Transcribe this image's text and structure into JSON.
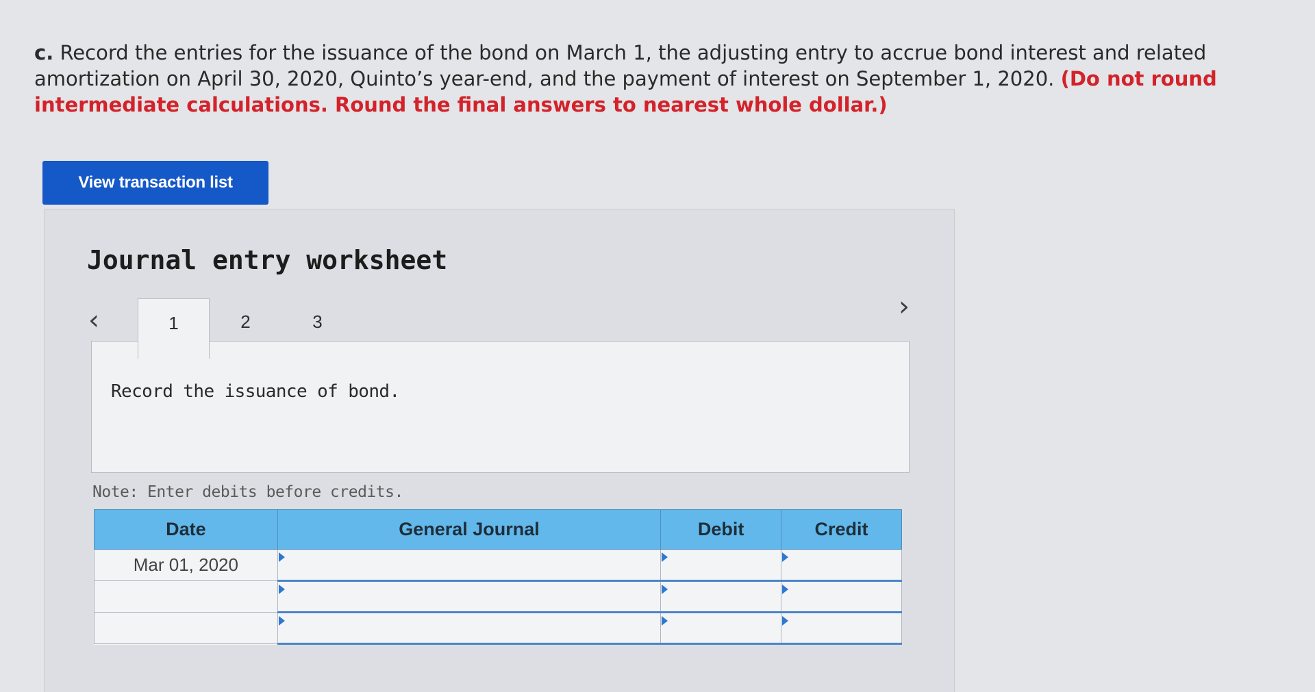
{
  "question": {
    "label": "c.",
    "text": "Record the entries for the issuance of the bond on March 1, the adjusting entry to accrue bond interest and related amortization on April 30, 2020, Quinto’s year-end, and the payment of interest on September 1, 2020.",
    "warning": "(Do not round intermediate calculations. Round the final answers to nearest whole dollar.)"
  },
  "view_button_label": "View transaction list",
  "worksheet": {
    "title": "Journal entry worksheet",
    "prev_icon": "chevron-left-icon",
    "next_icon": "chevron-right-icon",
    "tabs": [
      {
        "label": "1",
        "active": true
      },
      {
        "label": "2",
        "active": false
      },
      {
        "label": "3",
        "active": false
      }
    ],
    "prompt": "Record the issuance of bond.",
    "note": "Note: Enter debits before credits."
  },
  "journal": {
    "headers": {
      "date": "Date",
      "general_journal": "General Journal",
      "debit": "Debit",
      "credit": "Credit"
    },
    "rows": [
      {
        "date": "Mar 01, 2020",
        "account": "",
        "debit": "",
        "credit": ""
      },
      {
        "date": "",
        "account": "",
        "debit": "",
        "credit": ""
      },
      {
        "date": "",
        "account": "",
        "debit": "",
        "credit": ""
      }
    ]
  }
}
